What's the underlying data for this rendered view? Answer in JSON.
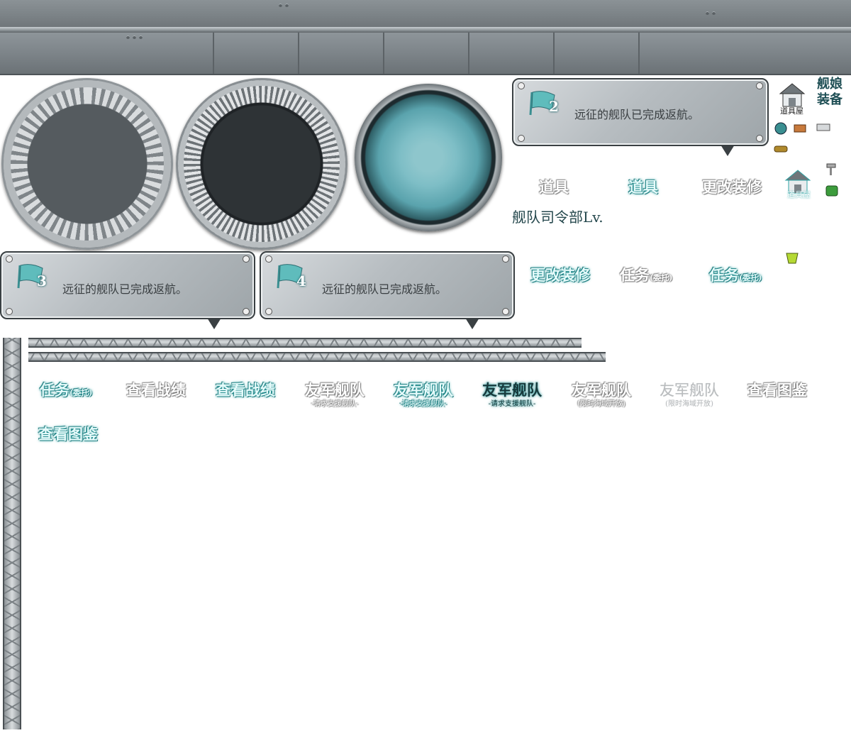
{
  "bubbles": [
    {
      "number": "2",
      "message": "远征的舰队已完成返航。"
    },
    {
      "number": "3",
      "message": "远征的舰队已完成返航。"
    },
    {
      "number": "4",
      "message": "远征的舰队已完成返航。"
    }
  ],
  "side_title": {
    "line1": "舰娘",
    "line2": "装备"
  },
  "shop_label": "道具屋",
  "hq_label": "舰队司令部Lv.",
  "buttons": {
    "items_white": "道具",
    "items_teal": "道具",
    "remodel_white": "更改装修",
    "remodel_teal": "更改装修",
    "quest_white_main": "任务",
    "quest_white_sub": "(委托)",
    "quest_teal_main": "任务",
    "quest_teal_sub": "(委托)",
    "quest_teal2_main": "任务",
    "quest_teal2_sub": "(委托)",
    "record_white": "查看战绩",
    "record_teal": "查看战绩",
    "friend_white_main": "友军舰队",
    "friend_white_sub": "-请求支援舰队-",
    "friend_teal_main": "友军舰队",
    "friend_teal_sub": "-请求支援舰队-",
    "friend_dark_main": "友军舰队",
    "friend_dark_sub": "-请求支援舰队-",
    "friend_grey1_main": "友军舰队",
    "friend_grey1_sub": "(限时海域开放)",
    "friend_grey2_main": "友军舰队",
    "friend_grey2_sub": "(限时海域开放)",
    "album_white": "查看图鉴",
    "album_teal": "查看图鉴"
  },
  "colors": {
    "teal_glow": "#2fa3a4",
    "steel": "#7d8489",
    "text_dark": "#3a3f42"
  }
}
